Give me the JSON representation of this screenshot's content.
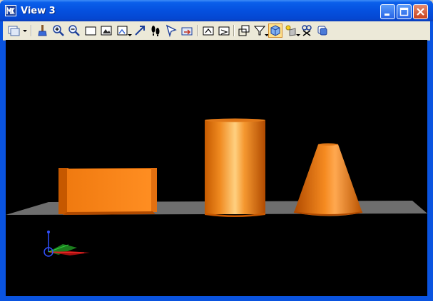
{
  "window": {
    "title": "View 3",
    "controls": [
      "minimize-icon",
      "maximize-icon",
      "close-icon"
    ]
  },
  "toolbar": {
    "tools": [
      {
        "name": "view-attributes",
        "icon": "view-groups-icon",
        "has_dropdown": true
      },
      {
        "name": "update-view",
        "icon": "brush-icon"
      },
      {
        "name": "zoom-in",
        "icon": "zoom-in-icon"
      },
      {
        "name": "zoom-out",
        "icon": "zoom-out-icon"
      },
      {
        "name": "window-area",
        "icon": "window-area-icon"
      },
      {
        "name": "fit-view",
        "icon": "fit-view-icon"
      },
      {
        "name": "rotate-view",
        "icon": "rotate-view-icon",
        "has_dropdown": true
      },
      {
        "name": "pan-view",
        "icon": "pan-icon"
      },
      {
        "name": "walk",
        "icon": "footsteps-icon"
      },
      {
        "name": "view-previous",
        "icon": "select-arrow-icon"
      },
      {
        "name": "view-next",
        "icon": "view-next-icon"
      },
      {
        "name": "copy-view",
        "icon": "copy-view-icon"
      },
      {
        "name": "view-properties",
        "icon": "view-properties-icon"
      },
      {
        "name": "clip-volume",
        "icon": "clip-volume-icon"
      },
      {
        "name": "clip-mask",
        "icon": "clip-mask-icon",
        "has_dropdown": true
      },
      {
        "name": "render-mode",
        "icon": "render-mode-icon",
        "active": true
      },
      {
        "name": "lighting",
        "icon": "lighting-icon",
        "has_dropdown": true
      },
      {
        "name": "camera",
        "icon": "camera-icon"
      },
      {
        "name": "display-style",
        "icon": "display-style-icon"
      }
    ]
  },
  "viewport": {
    "background": "#000000",
    "ground_color": "#6b6b6b",
    "solid_color": "#ff8a1c",
    "objects": [
      "box",
      "cylinder",
      "cone"
    ],
    "axis_triad": {
      "x_color": "#ff3030",
      "y_color": "#30d040",
      "z_color": "#3050ff"
    }
  }
}
